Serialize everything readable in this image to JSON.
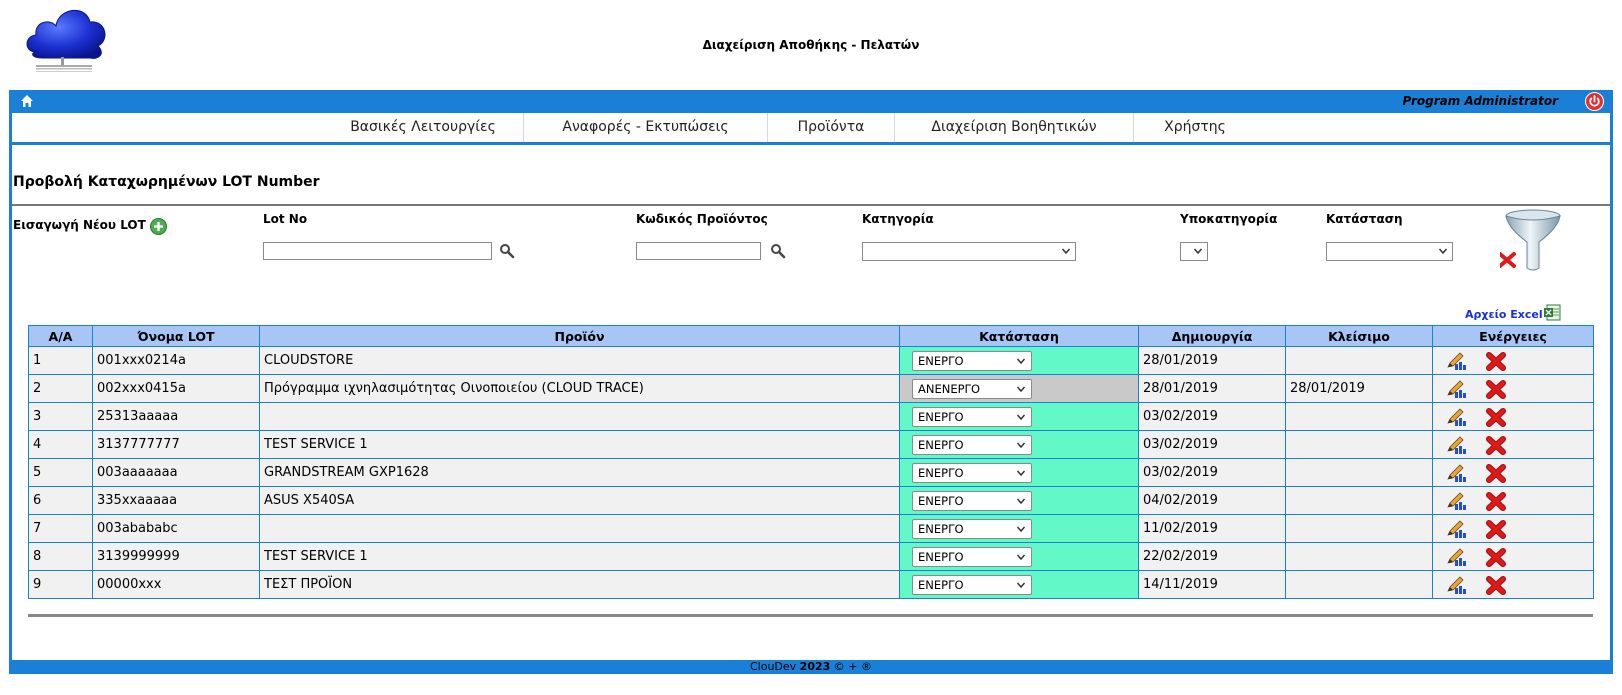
{
  "header": {
    "title": "Διαχείριση Αποθήκης - Πελατών",
    "user_name": "Program Administrator"
  },
  "nav": {
    "items": [
      {
        "label": "Βασικές Λειτουργίες"
      },
      {
        "label": "Αναφορές - Εκτυπώσεις"
      },
      {
        "label": "Προϊόντα"
      },
      {
        "label": "Διαχείριση Βοηθητικών"
      },
      {
        "label": "Χρήστης"
      }
    ]
  },
  "page": {
    "heading": "Προβολή Καταχωρημένων LOT Number",
    "new_lot_label": "Εισαγωγή Νέου LOT"
  },
  "filters": {
    "lot_no_label": "Lot No",
    "lot_no_value": "",
    "product_code_label": "Κωδικός Προϊόντος",
    "product_code_value": "",
    "category_label": "Κατηγορία",
    "category_value": "",
    "subcategory_label": "Υποκατηγορία",
    "subcategory_value": "",
    "status_label": "Κατάσταση",
    "status_value": ""
  },
  "excel": {
    "label": "Αρχείο Excel"
  },
  "table": {
    "headers": [
      "Α/Α",
      "Όνομα LOT",
      "Προϊόν",
      "Κατάσταση",
      "Δημιουργία",
      "Κλείσιμο",
      "Ενέργειες"
    ],
    "rows": [
      {
        "aa": "1",
        "lot": "001xxx0214a",
        "product": "CLOUDSTORE",
        "status": "ΕΝΕΡΓΟ",
        "created": "28/01/2019",
        "closed": ""
      },
      {
        "aa": "2",
        "lot": "002xxx0415a",
        "product": "Πρόγραμμα ιχνηλασιμότητας Οινοποιείου (CLOUD TRACE)",
        "status": "ΑΝΕΝΕΡΓΟ",
        "created": "28/01/2019",
        "closed": "28/01/2019"
      },
      {
        "aa": "3",
        "lot": "25313aaaaa",
        "product": "",
        "status": "ΕΝΕΡΓΟ",
        "created": "03/02/2019",
        "closed": ""
      },
      {
        "aa": "4",
        "lot": "3137777777",
        "product": "TEST SERVICE 1",
        "status": "ΕΝΕΡΓΟ",
        "created": "03/02/2019",
        "closed": ""
      },
      {
        "aa": "5",
        "lot": "003aaaaaaa",
        "product": "GRANDSTREAM GXP1628",
        "status": "ΕΝΕΡΓΟ",
        "created": "03/02/2019",
        "closed": ""
      },
      {
        "aa": "6",
        "lot": "335xxaaaaa",
        "product": "ASUS X540SA",
        "status": "ΕΝΕΡΓΟ",
        "created": "04/02/2019",
        "closed": ""
      },
      {
        "aa": "7",
        "lot": "003abababc",
        "product": "",
        "status": "ΕΝΕΡΓΟ",
        "created": "11/02/2019",
        "closed": ""
      },
      {
        "aa": "8",
        "lot": "3139999999",
        "product": "TEST SERVICE 1",
        "status": "ΕΝΕΡΓΟ",
        "created": "22/02/2019",
        "closed": ""
      },
      {
        "aa": "9",
        "lot": "00000xxx",
        "product": "ΤΕΣΤ ΠΡΟΪΟΝ",
        "status": "ΕΝΕΡΓΟ",
        "created": "14/11/2019",
        "closed": ""
      }
    ]
  },
  "footer": {
    "brand": "ClouDev",
    "year": "2023",
    "suffix": "© + ®"
  },
  "colors": {
    "primary": "#1a7fd6",
    "header_row": "#a7c6f5",
    "active_status": "#63f8c7",
    "inactive_status": "#c9c9c9"
  },
  "icons": [
    "cloud-logo-icon",
    "home-icon",
    "power-icon",
    "plus-icon",
    "magnifier-icon",
    "chevron-down-icon",
    "funnel-clear-icon",
    "excel-icon",
    "edit-pencil-icon",
    "delete-x-icon"
  ]
}
